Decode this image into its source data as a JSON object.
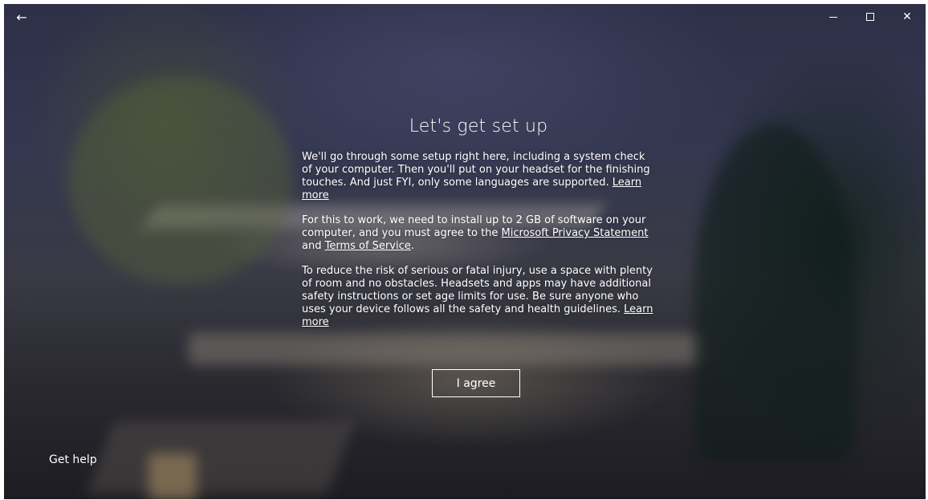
{
  "titlebar": {
    "back_glyph": "←",
    "minimize_glyph": "—",
    "close_glyph": "✕"
  },
  "main": {
    "title": "Let's get set up",
    "para1": {
      "text": "We'll go through some setup right here, including a system check of your computer. Then you'll put on your headset for the finishing touches. And just FYI, only some languages are supported. ",
      "link": "Learn more"
    },
    "para2": {
      "text_a": "For this to work, we need to install up to 2 GB of software on your computer, and you must agree to the ",
      "link_privacy": "Microsoft Privacy Statement",
      "text_b": " and ",
      "link_terms": "Terms of Service",
      "text_c": "."
    },
    "para3": {
      "text": "To reduce the risk of serious or fatal injury, use a space with plenty of room and no obstacles. Headsets and apps may have additional safety instructions or set age limits for use. Be sure anyone who uses your device follows all the safety and health guidelines. ",
      "link": "Learn more"
    },
    "agree_label": "I agree"
  },
  "footer": {
    "get_help_label": "Get help"
  },
  "colors": {
    "text": "#ffffff",
    "background_dark": "#2e3048"
  }
}
